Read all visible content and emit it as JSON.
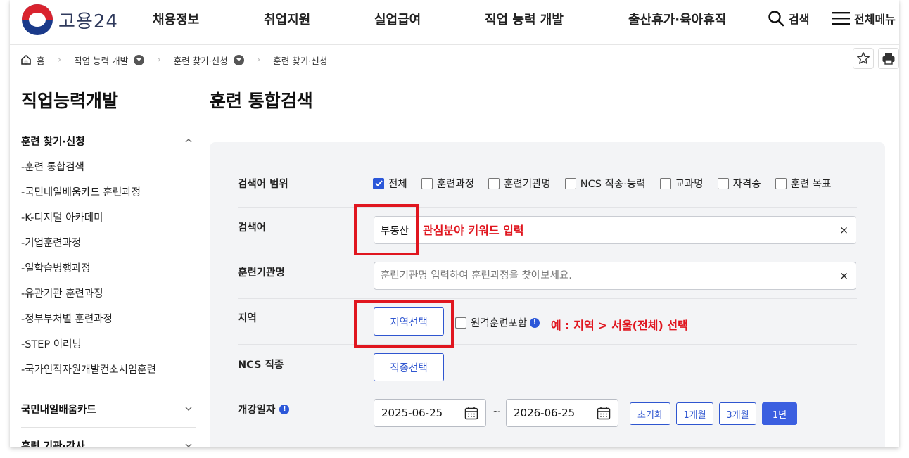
{
  "header": {
    "logo_text": "고용24",
    "nav": [
      "채용정보",
      "취업지원",
      "실업급여",
      "직업 능력 개발",
      "출산휴가·육아휴직"
    ],
    "search_label": "검색",
    "menu_label": "전체메뉴"
  },
  "breadcrumb": {
    "home": "홈",
    "items": [
      "직업 능력 개발",
      "훈련 찾기·신청",
      "훈련 찾기·신청"
    ]
  },
  "sidebar": {
    "title": "직업능력개발",
    "section1": "훈련 찾기·신청",
    "items": [
      "-훈련 통합검색",
      "-국민내일배움카드 훈련과정",
      "-K-디지털 아카데미",
      "-기업훈련과정",
      "-일학습병행과정",
      "-유관기관 훈련과정",
      "-정부부처별 훈련과정",
      "-STEP 이러닝",
      "-국가인적자원개발컨소시엄훈련"
    ],
    "section2": "국민내일배움카드",
    "section3": "훈련 기관·강사"
  },
  "main": {
    "title": "훈련 통합검색",
    "scope_label": "검색어 범위",
    "scope_options": [
      {
        "label": "전체",
        "checked": true
      },
      {
        "label": "훈련과정",
        "checked": false
      },
      {
        "label": "훈련기관명",
        "checked": false
      },
      {
        "label": "NCS 직종·능력",
        "checked": false
      },
      {
        "label": "교과명",
        "checked": false
      },
      {
        "label": "자격증",
        "checked": false
      },
      {
        "label": "훈련 목표",
        "checked": false
      }
    ],
    "keyword_label": "검색어",
    "keyword_value": "부동산",
    "institution_label": "훈련기관명",
    "institution_placeholder": "훈련기관명 입력하여 훈련과정을 찾아보세요.",
    "region_label": "지역",
    "region_button": "지역선택",
    "remote_label": "원격훈련포함",
    "ncs_label": "NCS 직종",
    "ncs_button": "직종선택",
    "date_label": "개강일자",
    "date_from": "2025-06-25",
    "date_tilde": "~",
    "date_to": "2026-06-25",
    "period_buttons": [
      "초기화",
      "1개월",
      "3개월",
      "1년"
    ],
    "active_period": "1년",
    "clear_symbol": "×"
  },
  "annotations": {
    "keyword_note": "관심분야 키워드 입력",
    "region_note": "예 : 지역 > 서울(전체) 선택"
  },
  "colors": {
    "accent": "#2f56d0",
    "highlight_red": "#e0161f",
    "panel_bg": "#f3f4f6"
  }
}
